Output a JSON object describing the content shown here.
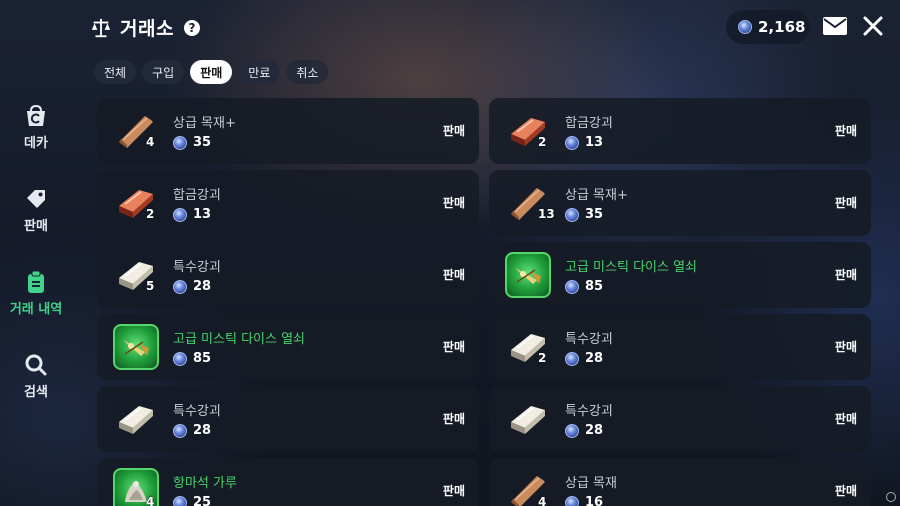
{
  "header": {
    "title": "거래소",
    "help": "?",
    "currency": "2,168"
  },
  "tabs": [
    {
      "label": "전체",
      "active": false
    },
    {
      "label": "구입",
      "active": false
    },
    {
      "label": "판매",
      "active": true
    },
    {
      "label": "만료",
      "active": false
    },
    {
      "label": "취소",
      "active": false
    }
  ],
  "sidebar": [
    {
      "label": "데카",
      "icon": "bag-icon",
      "active": false
    },
    {
      "label": "판매",
      "icon": "tag-icon",
      "active": false
    },
    {
      "label": "거래 내역",
      "icon": "clipboard-icon",
      "active": true
    },
    {
      "label": "검색",
      "icon": "search-icon",
      "active": false
    }
  ],
  "items": [
    {
      "name": "상급 목재+",
      "qty": "4",
      "price": "35",
      "action": "판매",
      "kind": "wood",
      "green": false
    },
    {
      "name": "합금강괴",
      "qty": "2",
      "price": "13",
      "action": "판매",
      "kind": "alloy",
      "green": false
    },
    {
      "name": "합금강괴",
      "qty": "2",
      "price": "13",
      "action": "판매",
      "kind": "alloy",
      "green": false
    },
    {
      "name": "상급 목재+",
      "qty": "13",
      "price": "35",
      "action": "판매",
      "kind": "wood",
      "green": false
    },
    {
      "name": "특수강괴",
      "qty": "5",
      "price": "28",
      "action": "판매",
      "kind": "silver",
      "green": false
    },
    {
      "name": "고급 미스틱 다이스 열쇠",
      "qty": "",
      "price": "85",
      "action": "판매",
      "kind": "mystic",
      "green": true
    },
    {
      "name": "고급 미스틱 다이스 열쇠",
      "qty": "",
      "price": "85",
      "action": "판매",
      "kind": "mystic",
      "green": true
    },
    {
      "name": "특수강괴",
      "qty": "2",
      "price": "28",
      "action": "판매",
      "kind": "silver",
      "green": false
    },
    {
      "name": "특수강괴",
      "qty": "",
      "price": "28",
      "action": "판매",
      "kind": "silver",
      "green": false
    },
    {
      "name": "특수강괴",
      "qty": "",
      "price": "28",
      "action": "판매",
      "kind": "silver",
      "green": false
    },
    {
      "name": "항마석 가루",
      "qty": "4",
      "price": "25",
      "action": "판매",
      "kind": "powder",
      "green": true
    },
    {
      "name": "상급 목재",
      "qty": "4",
      "price": "16",
      "action": "판매",
      "kind": "wood",
      "green": false
    }
  ]
}
